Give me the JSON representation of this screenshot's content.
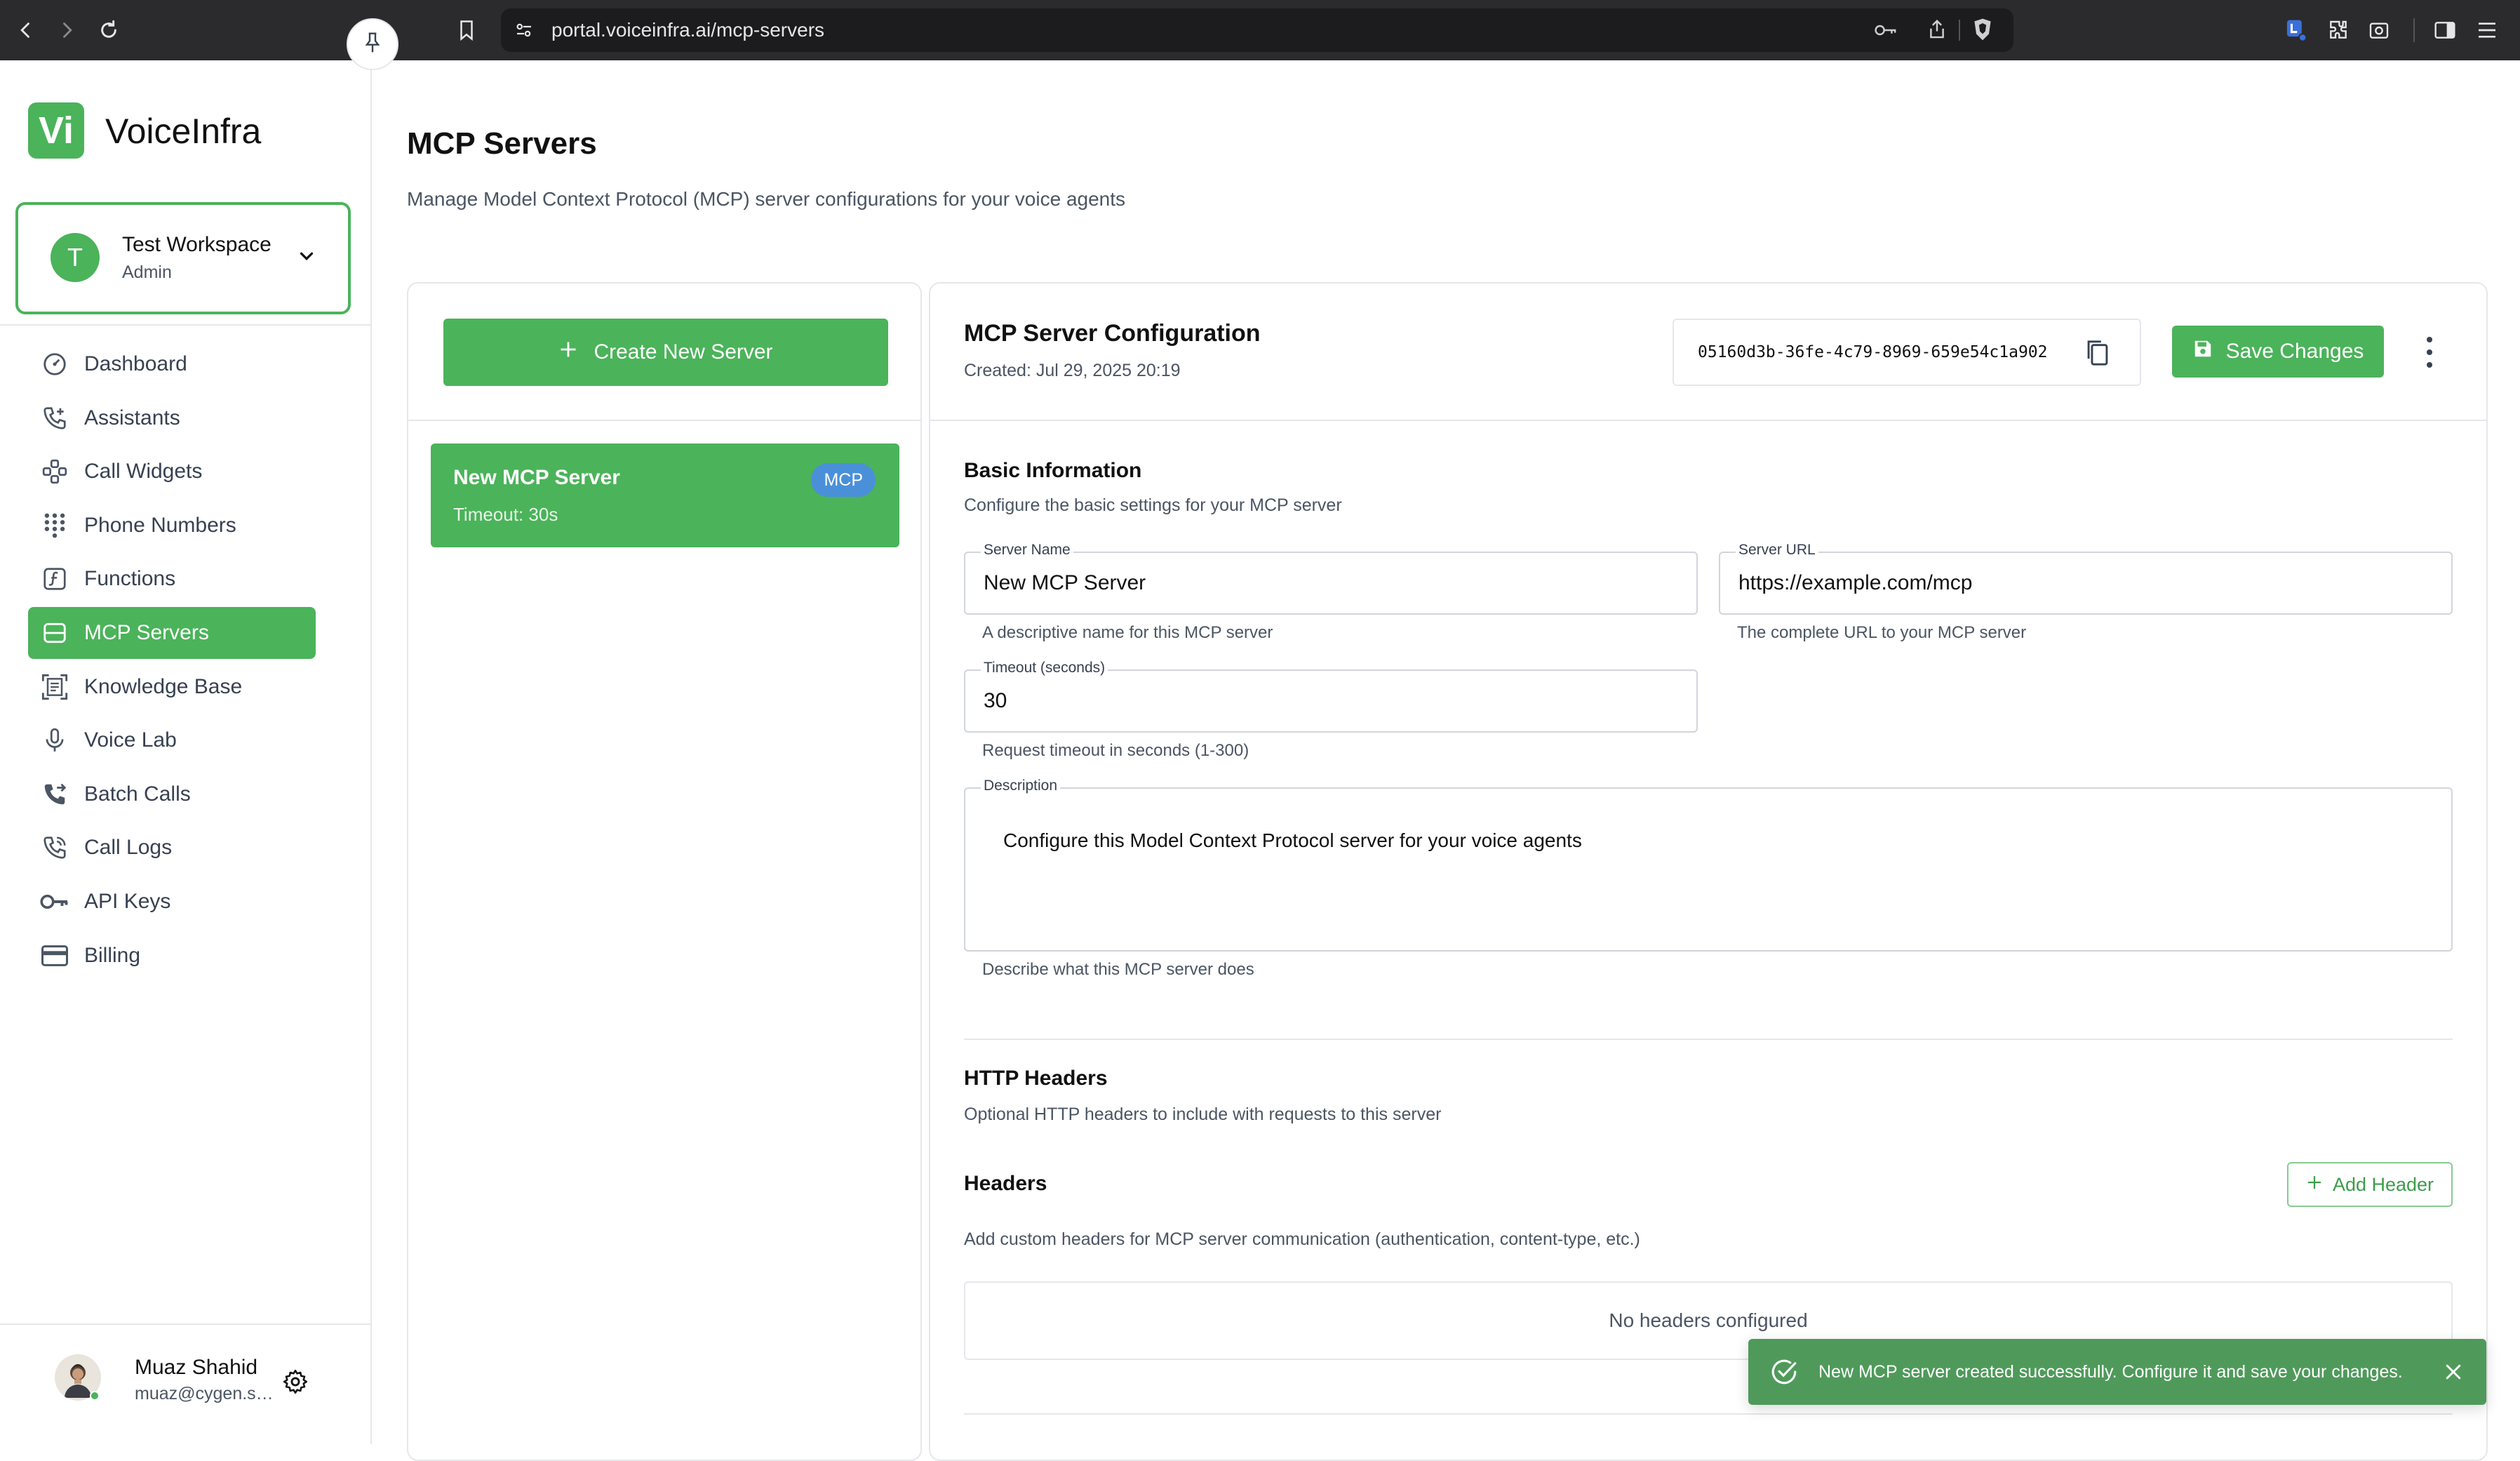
{
  "browser": {
    "url": "portal.voiceinfra.ai/mcp-servers"
  },
  "brand": {
    "logo_letters": "Vi",
    "name": "VoiceInfra",
    "accent_color": "#4bb35a"
  },
  "workspace": {
    "initial": "T",
    "name": "Test Workspace",
    "role": "Admin"
  },
  "sidebar": {
    "items": [
      {
        "label": "Dashboard",
        "icon": "dashboard-icon"
      },
      {
        "label": "Assistants",
        "icon": "phone-plus-icon"
      },
      {
        "label": "Call Widgets",
        "icon": "widget-icon"
      },
      {
        "label": "Phone Numbers",
        "icon": "dialpad-icon"
      },
      {
        "label": "Functions",
        "icon": "function-icon"
      },
      {
        "label": "MCP Servers",
        "icon": "server-icon",
        "active": true
      },
      {
        "label": "Knowledge Base",
        "icon": "document-scan-icon"
      },
      {
        "label": "Voice Lab",
        "icon": "microphone-icon"
      },
      {
        "label": "Batch Calls",
        "icon": "phone-forward-icon"
      },
      {
        "label": "Call Logs",
        "icon": "phone-log-icon"
      },
      {
        "label": "API Keys",
        "icon": "key-icon"
      },
      {
        "label": "Billing",
        "icon": "credit-card-icon"
      }
    ]
  },
  "user": {
    "name": "Muaz Shahid",
    "email": "muaz@cygen.sol..."
  },
  "page": {
    "title": "MCP Servers",
    "subtitle": "Manage Model Context Protocol (MCP) server configurations for your voice agents"
  },
  "server_list": {
    "create_label": "Create New Server",
    "servers": [
      {
        "name": "New MCP Server",
        "timeout": "Timeout: 30s",
        "badge": "MCP"
      }
    ]
  },
  "config": {
    "title": "MCP Server Configuration",
    "created": "Created: Jul 29, 2025 20:19",
    "server_id": "05160d3b-36fe-4c79-8969-659e54c1a902",
    "save_label": "Save Changes",
    "basic": {
      "title": "Basic Information",
      "subtitle": "Configure the basic settings for your MCP server",
      "server_name_label": "Server Name",
      "server_name_value": "New MCP Server",
      "server_name_help": "A descriptive name for this MCP server",
      "server_url_label": "Server URL",
      "server_url_value": "https://example.com/mcp",
      "server_url_help": "The complete URL to your MCP server",
      "timeout_label": "Timeout (seconds)",
      "timeout_value": "30",
      "timeout_help": "Request timeout in seconds (1-300)",
      "description_label": "Description",
      "description_value": "Configure this Model Context Protocol server for your voice agents",
      "description_help": "Describe what this MCP server does"
    },
    "http": {
      "title": "HTTP Headers",
      "subtitle": "Optional HTTP headers to include with requests to this server",
      "headers_title": "Headers",
      "add_label": "Add Header",
      "headers_subtitle": "Add custom headers for MCP server communication (authentication, content-type, etc.)",
      "empty_text": "No headers configured"
    }
  },
  "toast": {
    "message": "New MCP server created successfully. Configure it and save your changes."
  }
}
